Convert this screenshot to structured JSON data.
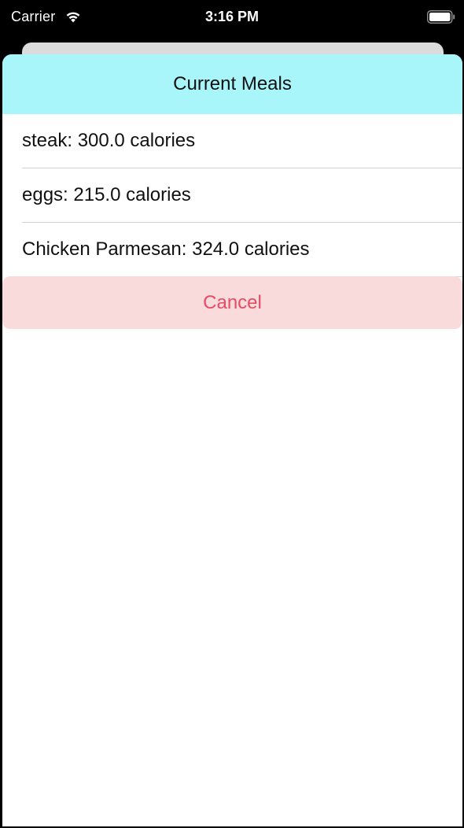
{
  "status_bar": {
    "carrier": "Carrier",
    "time": "3:16 PM",
    "wifi_icon": "wifi-icon",
    "battery_icon": "battery-icon"
  },
  "sheet": {
    "title": "Current Meals",
    "header_color": "#a8f5fa",
    "meals": [
      {
        "label": "steak: 300.0 calories"
      },
      {
        "label": "eggs: 215.0 calories"
      },
      {
        "label": "Chicken Parmesan: 324.0 calories"
      }
    ],
    "cancel_label": "Cancel",
    "cancel_color": "#e84c64",
    "cancel_background": "#f9dbdb"
  }
}
